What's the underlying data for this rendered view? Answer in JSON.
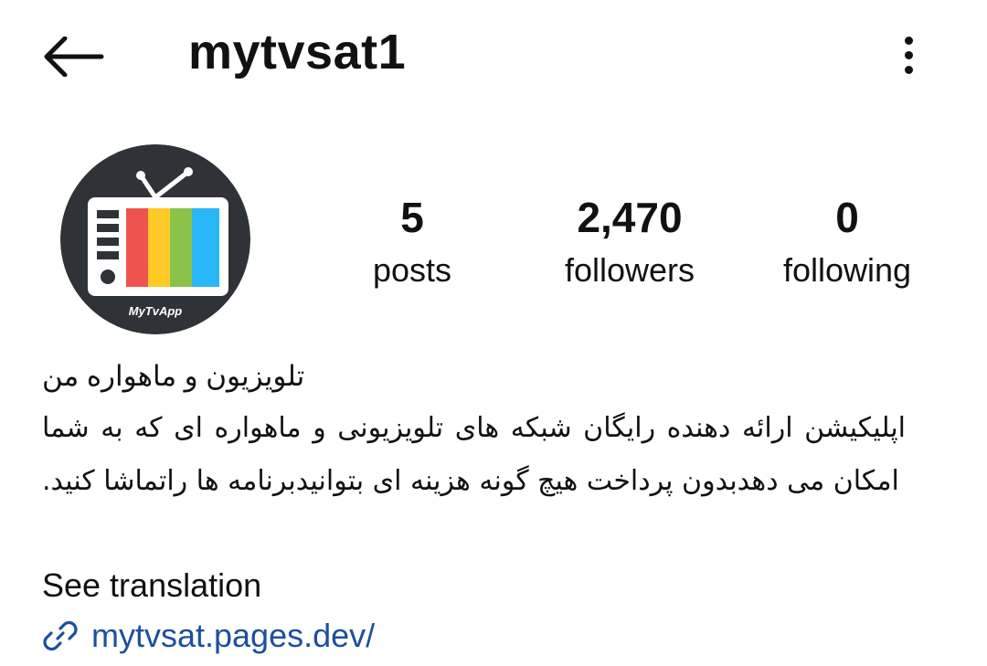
{
  "header": {
    "username": "mytvsat1",
    "back_icon": "arrow-left-icon",
    "menu_icon": "more-vertical-icon"
  },
  "profile": {
    "avatar_icon": "tv-logo-icon",
    "avatar_caption": "MyTvApp",
    "stats": [
      {
        "value": "5",
        "label": "posts"
      },
      {
        "value": "2,470",
        "label": "followers"
      },
      {
        "value": "0",
        "label": "following"
      }
    ]
  },
  "bio": {
    "name": "تلویزیون و ماهواره من",
    "text": "اپلیکیشن ارائه دهنده رایگان شبکه های تلویزیونی و ماهواره ای که به شما امکان می دهدبدون پرداخت هیچ گونه هزینه ای بتوانیدبرنامه ها راتماشا کنید.",
    "see_translation": "See translation",
    "link": "mytvsat.pages.dev/",
    "link_icon": "link-icon"
  },
  "colors": {
    "link": "#1d4f9e",
    "avatar_bg": "#2f3338",
    "stripes": [
      "#ef5350",
      "#ffca28",
      "#8bc34a",
      "#29b6f6"
    ]
  }
}
